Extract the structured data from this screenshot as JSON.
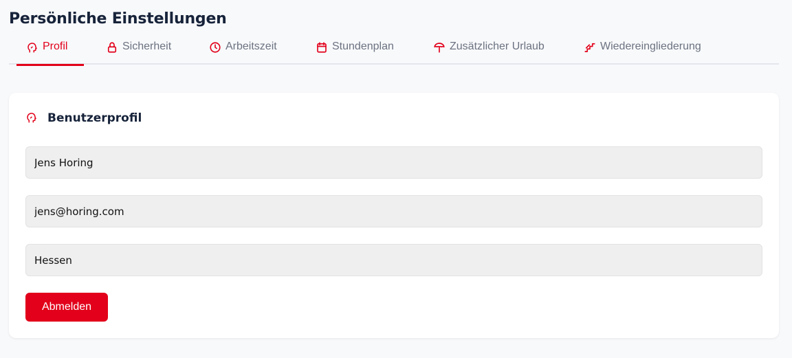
{
  "page": {
    "title": "Persönliche Einstellungen"
  },
  "tabs": [
    {
      "label": "Profil",
      "icon": "profile-head-icon",
      "active": true
    },
    {
      "label": "Sicherheit",
      "icon": "lock-icon",
      "active": false
    },
    {
      "label": "Arbeitszeit",
      "icon": "clock-icon",
      "active": false
    },
    {
      "label": "Stundenplan",
      "icon": "calendar-icon",
      "active": false
    },
    {
      "label": "Zusätzlicher Urlaub",
      "icon": "beach-umbrella-icon",
      "active": false
    },
    {
      "label": "Wiedereingliederung",
      "icon": "stairs-icon",
      "active": false
    }
  ],
  "profile_card": {
    "title": "Benutzerprofil",
    "icon": "profile-head-icon",
    "fields": {
      "name": "Jens Horing",
      "email": "jens@horing.com",
      "state": "Hessen"
    },
    "logout_label": "Abmelden"
  },
  "colors": {
    "accent": "#e2001a",
    "background": "#f8f9fb",
    "card": "#ffffff",
    "field_bg": "#efefef",
    "title": "#17233a",
    "tab_inactive": "#6b7280"
  }
}
